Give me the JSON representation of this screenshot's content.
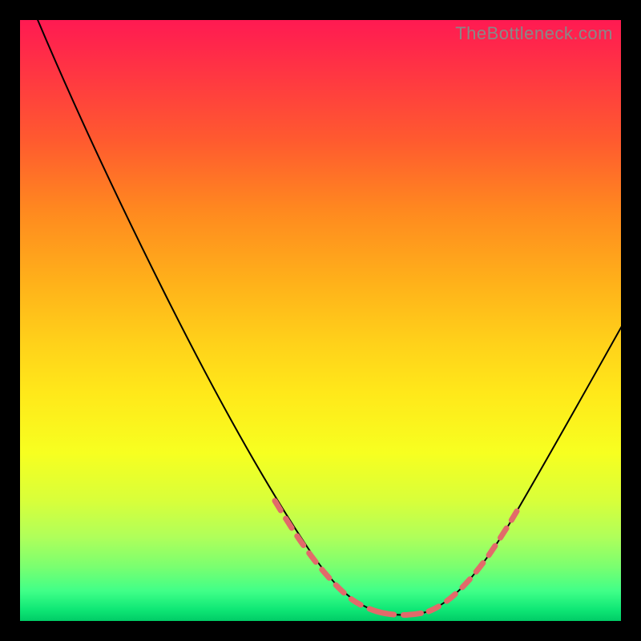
{
  "watermark": "TheBottleneck.com",
  "chart_data": {
    "type": "line",
    "title": "",
    "xlabel": "",
    "ylabel": "",
    "xlim": [
      0,
      100
    ],
    "ylim": [
      0,
      100
    ],
    "background_gradient": {
      "top": "#ff1a52",
      "mid": "#ffe81a",
      "bottom": "#00cc66"
    },
    "series": [
      {
        "name": "bottleneck-curve",
        "x": [
          0,
          5,
          12,
          20,
          28,
          36,
          42,
          46,
          50,
          54,
          58,
          62,
          66,
          72,
          80,
          90,
          100
        ],
        "values": [
          100,
          92,
          82,
          70,
          57,
          44,
          32,
          22,
          12,
          5,
          1,
          0,
          1,
          6,
          18,
          36,
          52
        ]
      }
    ],
    "highlight_segments": [
      {
        "name": "left-slope-dashes",
        "x_range": [
          40,
          54
        ]
      },
      {
        "name": "valley-dashes",
        "x_range": [
          54,
          66
        ]
      },
      {
        "name": "right-slope-dashes",
        "x_range": [
          66,
          76
        ]
      }
    ]
  }
}
